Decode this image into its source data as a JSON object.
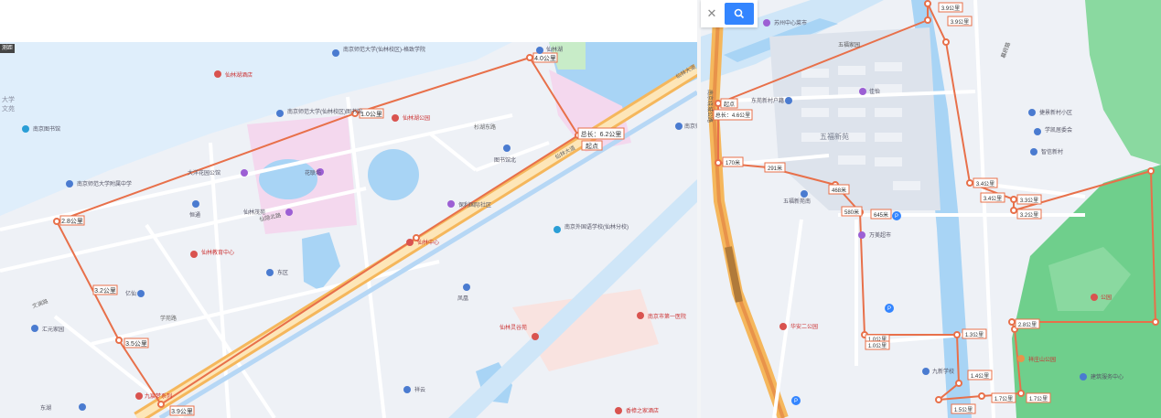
{
  "left_map": {
    "corner_tag": "测距",
    "route_total_label": "总长：6.2公里",
    "end_label": "起点",
    "distance_labels": [
      {
        "id": "d-1-0",
        "text": "1.0公里"
      },
      {
        "id": "d-2-8",
        "text": "2.8公里"
      },
      {
        "id": "d-3-2",
        "text": "3.2公里"
      },
      {
        "id": "d-3-5",
        "text": "3.5公里"
      },
      {
        "id": "d-3-9",
        "text": "3.9公里"
      },
      {
        "id": "d-4-0",
        "text": "4.0公里"
      }
    ],
    "pois": [
      {
        "id": "njsfdx",
        "text": "南京师范大学(仙林校区)-格致学院",
        "icon": "pin-icon",
        "color": "#4a7bd0"
      },
      {
        "id": "njsfdx-xlxq",
        "text": "南京师范大学(仙林校区)图书馆",
        "icon": "pin-icon",
        "color": "#4a7bd0"
      },
      {
        "id": "xianlin-hu",
        "text": "仙林湖",
        "icon": "pin-icon",
        "color": "#4a7bd0"
      },
      {
        "id": "jiudian",
        "text": "仙林湖酒店",
        "icon": "pin-icon",
        "color": "#d9534f"
      },
      {
        "id": "library",
        "text": "南京图书馆",
        "icon": "pin-icon",
        "color": "#2a9ed6"
      },
      {
        "id": "xianlin-gongyuan",
        "text": "仙林湖公园",
        "icon": "pin-icon",
        "color": "#d9534f"
      },
      {
        "id": "njsfdx-fuzhong",
        "text": "南京师范大学附属中学",
        "icon": "pin-icon",
        "color": "#4a7bd0"
      },
      {
        "id": "dayangjuhuacheng",
        "text": "大洋花园公馆",
        "icon": "pin-icon",
        "color": "#9c5fd4"
      },
      {
        "id": "hualianfang",
        "text": "花联坊",
        "icon": "pin-icon",
        "color": "#9c5fd4"
      },
      {
        "id": "xianlinmaodian",
        "text": "仙林茂苑",
        "icon": "pin-icon",
        "color": "#9c5fd4"
      },
      {
        "id": "hengtong",
        "text": "恒通",
        "icon": "pin-icon",
        "color": "#4a7bd0"
      },
      {
        "id": "baoli",
        "text": "保利国际社区",
        "icon": "pin-icon",
        "color": "#9c5fd4"
      },
      {
        "id": "xianlinjiaoyu",
        "text": "仙林教育中心",
        "icon": "pin-icon",
        "color": "#d9534f"
      },
      {
        "id": "dongqu",
        "text": "东区",
        "icon": "pin-icon",
        "color": "#4a7bd0"
      },
      {
        "id": "xianlinzhongxin",
        "text": "仙林中心",
        "icon": "pin-icon",
        "color": "#d9534f"
      },
      {
        "id": "nanjing-waiguoyu",
        "text": "南京外国语学校(仙林分校)",
        "icon": "pin-icon",
        "color": "#2a9ed6"
      },
      {
        "id": "fenghuang",
        "text": "凤凰",
        "icon": "pin-icon",
        "color": "#4a7bd0"
      },
      {
        "id": "tushuguanbei",
        "text": "图书馆北",
        "icon": "pin-icon",
        "color": "#4a7bd0"
      },
      {
        "id": "yixian",
        "text": "亿仙",
        "icon": "pin-icon",
        "color": "#4a7bd0"
      },
      {
        "id": "huiyuan",
        "text": "汇元家园",
        "icon": "pin-icon",
        "color": "#4a7bd0"
      },
      {
        "id": "donghu",
        "text": "东湖",
        "icon": "pin-icon",
        "color": "#4a7bd0"
      },
      {
        "id": "jiuchen",
        "text": "九宸梦系列",
        "icon": "pin-icon",
        "color": "#d9534f"
      },
      {
        "id": "zhongxin",
        "text": "仙林中心",
        "icon": "pin-icon",
        "color": "#d9534f"
      },
      {
        "id": "xiangyun",
        "text": "祥云",
        "icon": "pin-icon",
        "color": "#4a7bd0"
      },
      {
        "id": "nanjing-baiye",
        "text": "南京市第一医院",
        "icon": "pin-icon",
        "color": "#d9534f"
      },
      {
        "id": "yiyuan",
        "text": "香樟之家酒店",
        "icon": "pin-icon",
        "color": "#d9534f"
      },
      {
        "id": "xianlinlinggu",
        "text": "仙林灵谷苑",
        "icon": "pin-icon",
        "color": "#d9534f"
      },
      {
        "id": "wenyuan",
        "text": "文苑",
        "icon": "pin-icon",
        "color": "#4a7bd0"
      },
      {
        "id": "xianlinhu-zhongxue",
        "text": "仙林湖中学",
        "icon": "pin-icon",
        "color": "#d9534f"
      },
      {
        "id": "sfdx-right",
        "text": "南京师大",
        "icon": "pin-icon",
        "color": "#4a7bd0"
      }
    ],
    "roads": [
      {
        "id": "r-xianlin-dadao",
        "text": "仙林大道"
      },
      {
        "id": "r-wenlan",
        "text": "文澜路"
      },
      {
        "id": "r-xianyin",
        "text": "仙隐北路"
      },
      {
        "id": "r-yingxing",
        "text": "杉湖东路"
      },
      {
        "id": "r-xueyuan",
        "text": "学苑路"
      },
      {
        "id": "r-xianlin-da",
        "text": "仙林大道"
      }
    ],
    "area_labels": [
      {
        "id": "a-daxue",
        "text": "大学"
      },
      {
        "id": "a-wenyuan",
        "text": "文苑"
      }
    ]
  },
  "right_map": {
    "search": {
      "clear_icon": "close-icon",
      "search_icon": "search-icon"
    },
    "route_total_label": "总长：4.6公里",
    "start_label": "起点",
    "distance_labels": [
      {
        "id": "rd-170",
        "text": "170米"
      },
      {
        "id": "rd-291",
        "text": "291米"
      },
      {
        "id": "rd-468",
        "text": "468米"
      },
      {
        "id": "rd-580",
        "text": "580米"
      },
      {
        "id": "rd-645",
        "text": "645米"
      },
      {
        "id": "rd-1-0a",
        "text": "1.0公里"
      },
      {
        "id": "rd-1-0b",
        "text": "1.0公里"
      },
      {
        "id": "rd-1-3",
        "text": "1.3公里"
      },
      {
        "id": "rd-1-4",
        "text": "1.4公里"
      },
      {
        "id": "rd-1-5",
        "text": "1.5公里"
      },
      {
        "id": "rd-1-7a",
        "text": "1.7公里"
      },
      {
        "id": "rd-1-7b",
        "text": "1.7公里"
      },
      {
        "id": "rd-2-8",
        "text": "2.8公里"
      },
      {
        "id": "rd-3-2",
        "text": "3.2公里"
      },
      {
        "id": "rd-3-3",
        "text": "3.3公里"
      },
      {
        "id": "rd-3-4a",
        "text": "3.4公里"
      },
      {
        "id": "rd-3-4b",
        "text": "3.4公里"
      },
      {
        "id": "rd-3-9a",
        "text": "3.9公里"
      },
      {
        "id": "rd-3-9b",
        "text": "3.9公里"
      }
    ],
    "pois": [
      {
        "id": "suzhoumenxin",
        "text": "苏州中心菜市",
        "color": "#9c5fd4"
      },
      {
        "id": "dongyuan",
        "text": "东苑新村户籍",
        "color": "#4a7bd0"
      },
      {
        "id": "jiayi",
        "text": "佳怡",
        "color": "#9c5fd4"
      },
      {
        "id": "wufuxinyuan",
        "text": "五福新苑",
        "color": "#4a7bd0"
      },
      {
        "id": "wufuxinyuan-b",
        "text": "五福新苑南",
        "color": "#4a7bd0"
      },
      {
        "id": "wanmei",
        "text": "万美超市",
        "color": "#9c5fd4"
      },
      {
        "id": "huaxin",
        "text": "华安二公园",
        "color": "#d9534f"
      },
      {
        "id": "jiuxin",
        "text": "九新学校",
        "color": "#4a7bd0"
      },
      {
        "id": "jiejing",
        "text": "捷景新村小区",
        "color": "#4a7bd0"
      },
      {
        "id": "xuekai",
        "text": "学凯居委会",
        "color": "#4a7bd0"
      },
      {
        "id": "gongyuan",
        "text": "公园",
        "color": "#d9534f"
      },
      {
        "id": "zhixin",
        "text": "智信新村",
        "color": "#4a7bd0"
      },
      {
        "id": "parking-1",
        "text": "P",
        "color": "#3385ff"
      },
      {
        "id": "parking-2",
        "text": "P",
        "color": "#3385ff"
      },
      {
        "id": "parking-3",
        "text": "P",
        "color": "#3385ff"
      },
      {
        "id": "xiangzhuang",
        "text": "祥庄山公园",
        "color": "#d9534f"
      },
      {
        "id": "jianzhu",
        "text": "建筑服务中心",
        "color": "#4a7bd0"
      }
    ],
    "roads": [
      {
        "id": "rr-nanjing",
        "text": "南京绕城公路"
      },
      {
        "id": "rr-mufu",
        "text": "幕府路"
      },
      {
        "id": "rr-wufu",
        "text": "五福家园"
      }
    ]
  },
  "colors": {
    "route": "#e8704a",
    "water": "#a8d4f5",
    "green": "#6fcf8c",
    "road": "#ffffff",
    "highway": "#f5b75c",
    "map_bg": "#eef1f6",
    "search_blue": "#3385ff"
  }
}
